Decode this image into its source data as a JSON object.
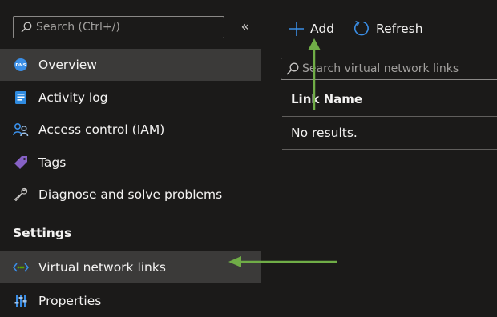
{
  "sidebar": {
    "search_placeholder": "Search (Ctrl+/)",
    "collapse_glyph": "«",
    "items": [
      {
        "label": "Overview",
        "icon": "dns-icon"
      },
      {
        "label": "Activity log",
        "icon": "activity-log-icon"
      },
      {
        "label": "Access control (IAM)",
        "icon": "people-icon"
      },
      {
        "label": "Tags",
        "icon": "tag-icon"
      },
      {
        "label": "Diagnose and solve problems",
        "icon": "wrench-icon"
      }
    ],
    "settings_label": "Settings",
    "settings_items": [
      {
        "label": "Virtual network links",
        "icon": "virtual-network-icon"
      },
      {
        "label": "Properties",
        "icon": "properties-icon"
      }
    ]
  },
  "toolbar": {
    "add_label": "Add",
    "refresh_label": "Refresh"
  },
  "main": {
    "search_placeholder": "Search virtual network links",
    "column_header": "Link Name",
    "empty_text": "No results."
  },
  "colors": {
    "background": "#1b1a19",
    "selected": "#3b3a39",
    "accent": "#0078d4",
    "annotation_arrow": "#70ad47"
  }
}
